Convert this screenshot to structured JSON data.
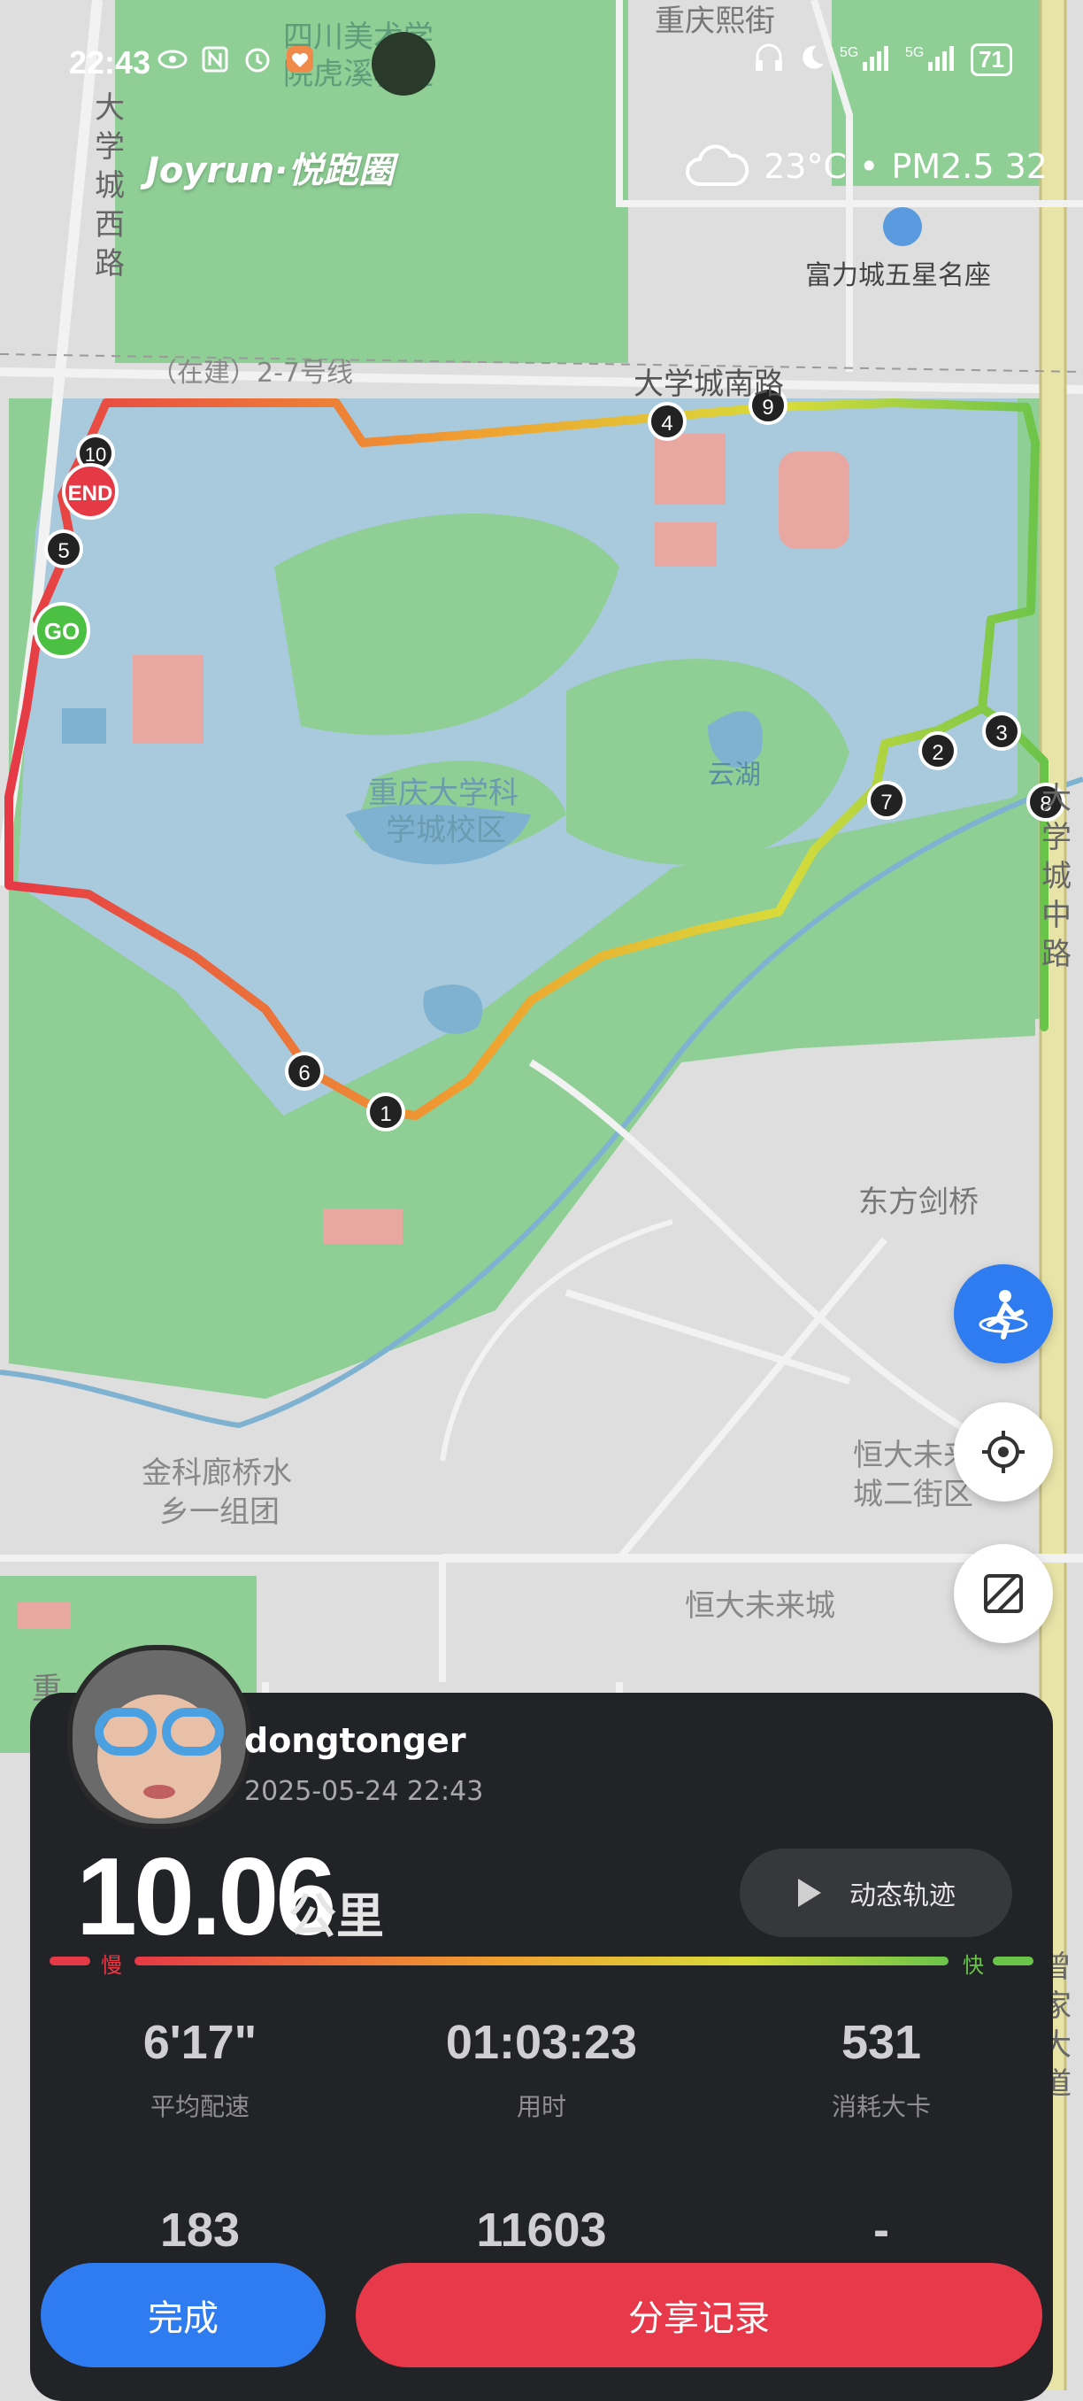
{
  "status_bar": {
    "time": "22:43",
    "battery": "71"
  },
  "map": {
    "brand": "Joyrun·悦跑圈",
    "weather": {
      "temp": "23°C",
      "separator": "•",
      "aqi": "PM2.5 32"
    },
    "labels": {
      "school_top": "四川美术学",
      "school_top_2": "院虎溪校区",
      "chongqing_xijie": "重庆熙街",
      "fulicheng": "富力城五星名座",
      "line27": "（在建）2-7号线",
      "daxuecheng_nan": "大学城南路",
      "cqu_1": "重庆大学科",
      "cqu_2": "学城校区",
      "yunhu": "云湖",
      "dongfang_jianqiao": "东方剑桥",
      "jinke_1": "金科廊桥水",
      "jinke_2": "乡一组团",
      "hengda_er_1": "恒大未来",
      "hengda_er_2": "城二街区",
      "hengda": "恒大未来城",
      "west_road": "大学城西路",
      "middle_road": "大学城中路",
      "zeng_road": "曾家大道",
      "chong_partial": "重"
    },
    "markers": {
      "start": "GO",
      "end": "END",
      "km": [
        "1",
        "2",
        "3",
        "4",
        "5",
        "6",
        "7",
        "8",
        "9",
        "10"
      ]
    }
  },
  "result": {
    "username": "dongtonger",
    "datetime": "2025-05-24 22:43",
    "distance": "10.06",
    "distance_unit": "公里",
    "replay_label": "动态轨迹",
    "legend_slow": "慢",
    "legend_fast": "快",
    "stats": [
      {
        "value": "6'17\"",
        "label": "平均配速"
      },
      {
        "value": "01:03:23",
        "label": "用时"
      },
      {
        "value": "531",
        "label": "消耗大卡"
      },
      {
        "value": "183",
        "label": ""
      },
      {
        "value": "11603",
        "label": ""
      },
      {
        "value": "-",
        "label": ""
      }
    ]
  },
  "buttons": {
    "done": "完成",
    "share": "分享记录"
  },
  "colors": {
    "map_bg": "#dedede",
    "campus_green": "#8fcf96",
    "water": "#a9c9dd",
    "card_bg": "#222327",
    "accent_blue": "#2f7bf0",
    "accent_red": "#e8394a"
  }
}
